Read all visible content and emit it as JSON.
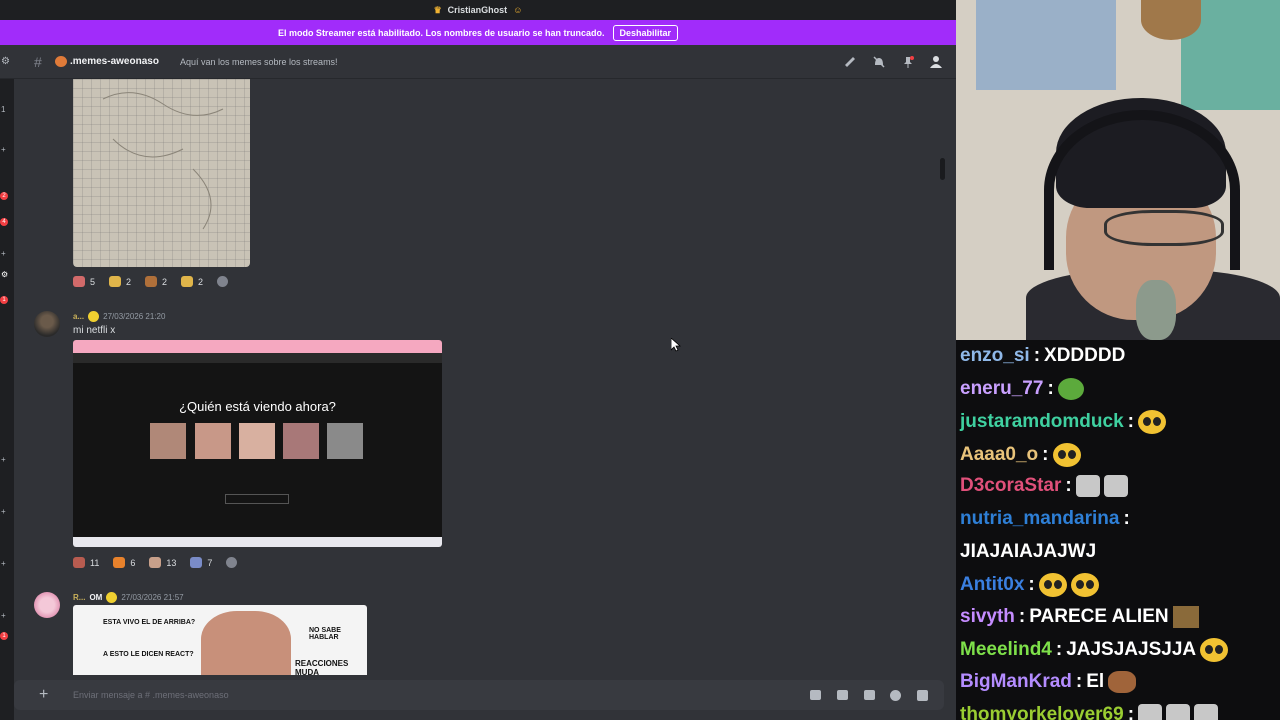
{
  "titlebar": {
    "title": "CristianGhost"
  },
  "streamer_banner": {
    "text": "El modo Streamer está habilitado. Los nombres de usuario se han truncado.",
    "button": "Deshabilitar"
  },
  "channel": {
    "name": ".memes-aweonaso",
    "topic": "Aquí van los memes sobre los streams!"
  },
  "rail_badges": [
    "1",
    "2",
    "4",
    "1",
    "1"
  ],
  "messages": [
    {
      "reactions": [
        {
          "count": "5",
          "color": "#d26a6a"
        },
        {
          "count": "2",
          "color": "#e0b54a"
        },
        {
          "count": "2",
          "color": "#b0703a"
        },
        {
          "count": "2",
          "color": "#e0b54a"
        }
      ]
    },
    {
      "author": "a...",
      "timestamp": "27/03/2026 21:20",
      "content": "mi netfli x",
      "embed_title": "¿Quién está viendo ahora?",
      "reactions": [
        {
          "count": "11",
          "color": "#b85c50"
        },
        {
          "count": "6",
          "color": "#e8822c"
        },
        {
          "count": "13",
          "color": "#c8a08a"
        },
        {
          "count": "7",
          "color": "#7a8cc8"
        }
      ]
    },
    {
      "author": "R...",
      "badge": "OM",
      "timestamp": "27/03/2026 21:57",
      "meme_texts": [
        "ESTA VIVO EL DE ARRIBA?",
        "A ESTO LE DICEN REACT?",
        "NO SABE HABLAR",
        "REACCIONES MUDA"
      ]
    }
  ],
  "composer": {
    "placeholder": "Enviar mensaje a #  .memes-aweonaso"
  },
  "chat": [
    {
      "user": "enzo_si",
      "color": "#8fb8e8",
      "text": "XDDDDD",
      "emotes": []
    },
    {
      "user": "eneru_77",
      "color": "#c9a0ff",
      "text": "",
      "emotes": [
        "frog"
      ]
    },
    {
      "user": "justaramdomduck",
      "color": "#3fd0a0",
      "text": "",
      "emotes": [
        "em"
      ]
    },
    {
      "user": "Aaaa0_o",
      "color": "#e8c37a",
      "text": "",
      "emotes": [
        "em"
      ]
    },
    {
      "user": "D3coraStar",
      "color": "#e0507a",
      "text": "",
      "emotes": [
        "cat",
        "cat"
      ]
    },
    {
      "user": "nutria_mandarina",
      "color": "#2e7fd6",
      "text": "",
      "emotes": []
    },
    {
      "user": "",
      "color": "#fff",
      "text": "JIAJAIAJAJWJ",
      "emotes": []
    },
    {
      "user": "Antit0x",
      "color": "#3a7fe0",
      "text": "",
      "emotes": [
        "em",
        "em"
      ]
    },
    {
      "user": "sivyth",
      "color": "#c58cff",
      "text": "PARECE ALIEN",
      "emotes": [
        "alien"
      ]
    },
    {
      "user": "Meeelind4",
      "color": "#7ee04a",
      "text": "JAJSJAJSJJA",
      "emotes": [
        "em"
      ]
    },
    {
      "user": "BigManKrad",
      "color": "#b48cff",
      "text": "El",
      "emotes": [
        "dog"
      ]
    },
    {
      "user": "thomyorkelover69",
      "color": "#9acd32",
      "text": "",
      "emotes": [
        "cat",
        "cat",
        "cat"
      ]
    }
  ]
}
